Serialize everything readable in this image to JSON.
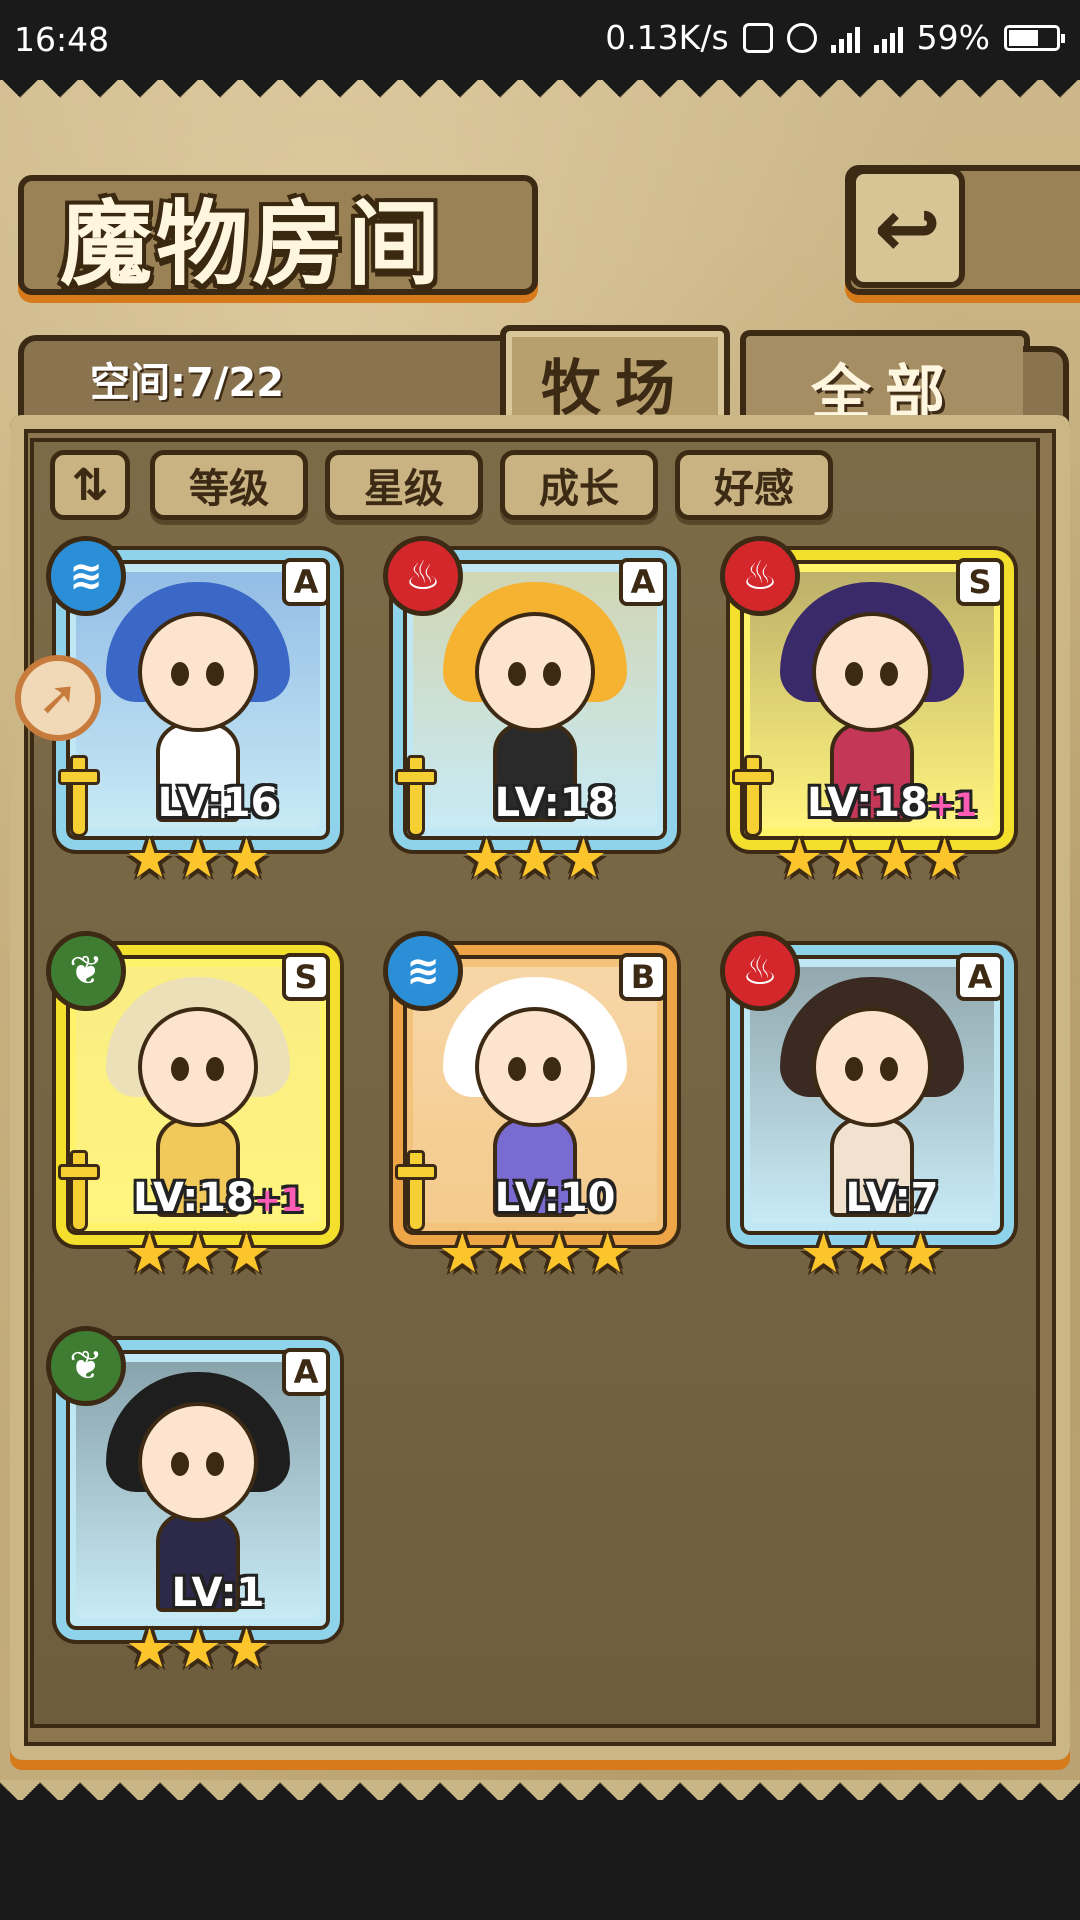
{
  "status_bar": {
    "time": "16:48",
    "net_speed": "0.13K/s",
    "battery": "59%"
  },
  "title": "魔物房间",
  "back_icon": "return-arrow-icon",
  "space": "空间:7/22",
  "tabs": [
    {
      "label": "牧场",
      "active": true
    },
    {
      "label": "全部",
      "active": false
    }
  ],
  "sort_toggle_icon": "order-toggle-icon",
  "sort_buttons": [
    "等级",
    "星级",
    "成长",
    "好感"
  ],
  "colors": {
    "fire": "#d3272c",
    "water": "#2b8fd8",
    "wood": "#3f7d33",
    "frame_A": "#8fd3ea",
    "frame_S": "#f4e02c",
    "frame_B": "#eea547",
    "star": "#fbc52b"
  },
  "monsters": [
    {
      "rank": "A",
      "element": "water",
      "element_glyph": "≋",
      "level": "LV:16",
      "plus": "",
      "stars": 3,
      "has_sword": true,
      "hair": "#3b67c7",
      "body": "#ffffff"
    },
    {
      "rank": "A",
      "element": "fire",
      "element_glyph": "♨",
      "level": "LV:18",
      "plus": "",
      "stars": 3,
      "has_sword": true,
      "hair": "#f5b331",
      "body": "#2a2a2a"
    },
    {
      "rank": "S",
      "element": "fire",
      "element_glyph": "♨",
      "level": "LV:18",
      "plus": "+1",
      "stars": 4,
      "has_sword": true,
      "hair": "#3a2a6a",
      "body": "#c53757"
    },
    {
      "rank": "S",
      "element": "wood",
      "element_glyph": "❦",
      "level": "LV:18",
      "plus": "+1",
      "stars": 3,
      "has_sword": true,
      "hair": "#ece0b8",
      "body": "#f0c95a"
    },
    {
      "rank": "B",
      "element": "water",
      "element_glyph": "≋",
      "level": "LV:10",
      "plus": "",
      "stars": 4,
      "has_sword": true,
      "hair": "#ffffff",
      "body": "#7a6bd1"
    },
    {
      "rank": "A",
      "element": "fire",
      "element_glyph": "♨",
      "level": "LV:7",
      "plus": "",
      "stars": 3,
      "has_sword": false,
      "hair": "#3a2a22",
      "body": "#f1e2d0"
    },
    {
      "rank": "A",
      "element": "wood",
      "element_glyph": "❦",
      "level": "LV:1",
      "plus": "",
      "stars": 3,
      "has_sword": false,
      "hair": "#1e1e1e",
      "body": "#2c2a48"
    }
  ]
}
